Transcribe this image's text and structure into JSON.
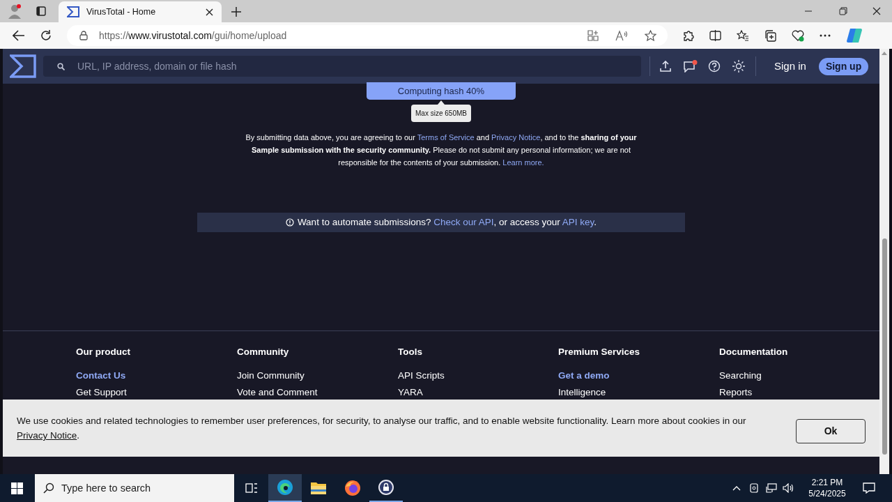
{
  "browser": {
    "tabs": [
      {
        "title": "VirusTotal - Home",
        "selected": true
      }
    ],
    "address": {
      "scheme": "https://",
      "host": "www.virustotal.com",
      "path": "/gui/home/upload"
    }
  },
  "header": {
    "search_placeholder": "URL, IP address, domain or file hash",
    "notification_dot": true,
    "sign_in": "Sign in",
    "sign_up": "Sign up"
  },
  "upload": {
    "button": "Computing hash 40%",
    "level": 0.4,
    "tooltip": "Max size 650MB"
  },
  "disclaimer": [
    {
      "kind": "text",
      "text": "By submitting data above, you are agreeing to our "
    },
    {
      "kind": "link",
      "text": "Terms of Service"
    },
    {
      "kind": "text",
      "text": " and "
    },
    {
      "kind": "link",
      "text": "Privacy Notice"
    },
    {
      "kind": "text",
      "text": ", and to the **sharing of your Sample submission with the security community.** Please do not submit any personal information; we are not responsible for the contents of your submission. "
    },
    {
      "kind": "link",
      "text": "Learn more."
    }
  ],
  "api_notice": [
    {
      "kind": "text",
      "text": "Want to automate submissions? "
    },
    {
      "kind": "link",
      "text": "Check our API"
    },
    {
      "kind": "text",
      "text": ", or access your "
    },
    {
      "kind": "link",
      "text": "API key"
    },
    {
      "kind": "text",
      "text": "."
    }
  ],
  "footer": [
    {
      "heading": "Our product",
      "links": [
        {
          "text": "Contact Us",
          "highlighted": true
        },
        {
          "text": "Get Support",
          "highlighted": false
        }
      ]
    },
    {
      "heading": "Community",
      "links": [
        {
          "text": "Join Community",
          "highlighted": false
        },
        {
          "text": "Vote and Comment",
          "highlighted": false
        }
      ]
    },
    {
      "heading": "Tools",
      "links": [
        {
          "text": "API Scripts",
          "highlighted": false
        },
        {
          "text": "YARA",
          "highlighted": false
        }
      ]
    },
    {
      "heading": "Premium Services",
      "links": [
        {
          "text": "Get a demo",
          "highlighted": true
        },
        {
          "text": "Intelligence",
          "highlighted": false
        }
      ]
    },
    {
      "heading": "Documentation",
      "links": [
        {
          "text": "Searching",
          "highlighted": false
        },
        {
          "text": "Reports",
          "highlighted": false
        }
      ]
    }
  ],
  "cookie_banner": {
    "message": [
      {
        "kind": "text",
        "text": "We use cookies and related technologies to remember user preferences, for security, to analyse our traffic, and to enable website functionality. Learn more about cookies in our "
      },
      {
        "kind": "link",
        "text": "Privacy Notice"
      },
      {
        "kind": "text",
        "text": "."
      }
    ],
    "button": "Ok"
  },
  "taskbar": {
    "search_placeholder": "Type here to search",
    "time": "2:21 PM",
    "date": "5/24/2025"
  }
}
